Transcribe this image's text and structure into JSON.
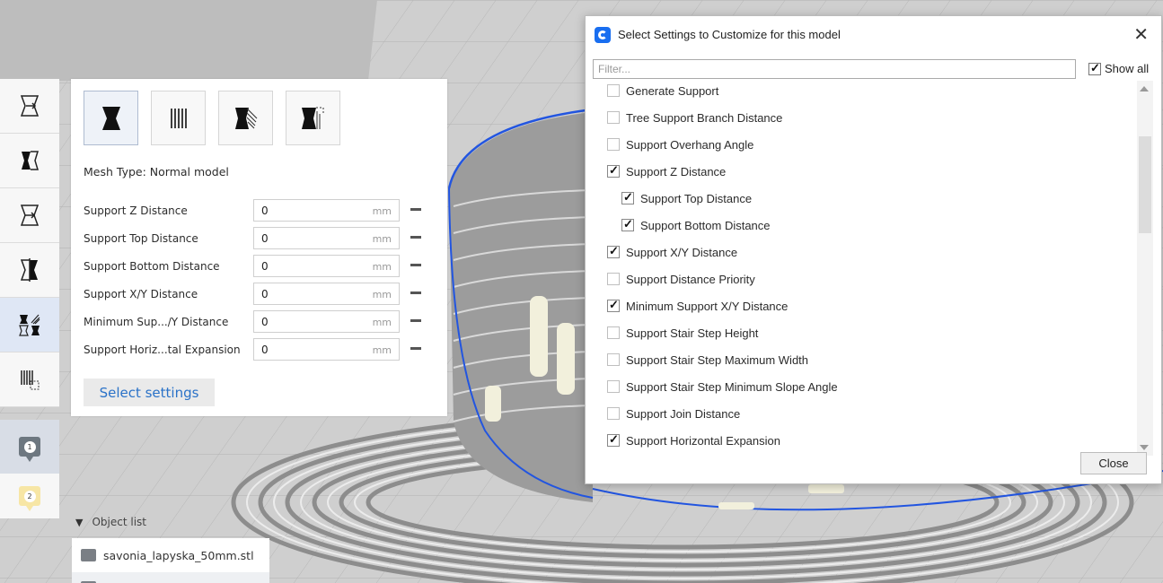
{
  "toolbar": {
    "tools": [
      {
        "icon": "move-icon",
        "active": false
      },
      {
        "icon": "scale-icon",
        "active": false
      },
      {
        "icon": "rotate-icon",
        "active": false
      },
      {
        "icon": "mirror-icon",
        "active": false
      },
      {
        "icon": "per-model-settings-icon",
        "active": true
      },
      {
        "icon": "support-blocker-icon",
        "active": false
      }
    ],
    "extra": [
      {
        "icon": "marker-icon",
        "number": "1",
        "active": true
      },
      {
        "icon": "marker-icon",
        "number": "2",
        "active": false
      }
    ]
  },
  "panel": {
    "mesh_type_label": "Mesh Type: Normal model",
    "mesh_types": [
      {
        "name": "normal-model",
        "active": true
      },
      {
        "name": "print-as-support",
        "active": false
      },
      {
        "name": "modify-overlaps",
        "active": false
      },
      {
        "name": "dont-support-overlaps",
        "active": false
      }
    ],
    "settings": [
      {
        "label": "Support Z Distance",
        "value": "0",
        "unit": "mm"
      },
      {
        "label": "Support Top Distance",
        "value": "0",
        "unit": "mm"
      },
      {
        "label": "Support Bottom Distance",
        "value": "0",
        "unit": "mm"
      },
      {
        "label": "Support X/Y Distance",
        "value": "0",
        "unit": "mm"
      },
      {
        "label": "Minimum Sup.../Y Distance",
        "value": "0",
        "unit": "mm"
      },
      {
        "label": "Support Horiz...tal Expansion",
        "value": "0",
        "unit": "mm"
      }
    ],
    "select_settings_label": "Select settings"
  },
  "object_list": {
    "header": "Object list",
    "items": [
      "savonia_lapyska_50mm.stl"
    ]
  },
  "dialog": {
    "title": "Select Settings to Customize for this model",
    "close_glyph": "✕",
    "filter_placeholder": "Filter...",
    "show_all_label": "Show all",
    "show_all_checked": true,
    "items": [
      {
        "label": "Generate Support",
        "checked": false,
        "indent": 0
      },
      {
        "label": "Tree Support Branch Distance",
        "checked": false,
        "indent": 0
      },
      {
        "label": "Support Overhang Angle",
        "checked": false,
        "indent": 0
      },
      {
        "label": "Support Z Distance",
        "checked": true,
        "indent": 0
      },
      {
        "label": "Support Top Distance",
        "checked": true,
        "indent": 1
      },
      {
        "label": "Support Bottom Distance",
        "checked": true,
        "indent": 1
      },
      {
        "label": "Support X/Y Distance",
        "checked": true,
        "indent": 0
      },
      {
        "label": "Support Distance Priority",
        "checked": false,
        "indent": 0
      },
      {
        "label": "Minimum Support X/Y Distance",
        "checked": true,
        "indent": 0
      },
      {
        "label": "Support Stair Step Height",
        "checked": false,
        "indent": 0
      },
      {
        "label": "Support Stair Step Maximum Width",
        "checked": false,
        "indent": 0
      },
      {
        "label": "Support Stair Step Minimum Slope Angle",
        "checked": false,
        "indent": 0
      },
      {
        "label": "Support Join Distance",
        "checked": false,
        "indent": 0
      },
      {
        "label": "Support Horizontal Expansion",
        "checked": true,
        "indent": 0
      }
    ],
    "close_label": "Close"
  }
}
